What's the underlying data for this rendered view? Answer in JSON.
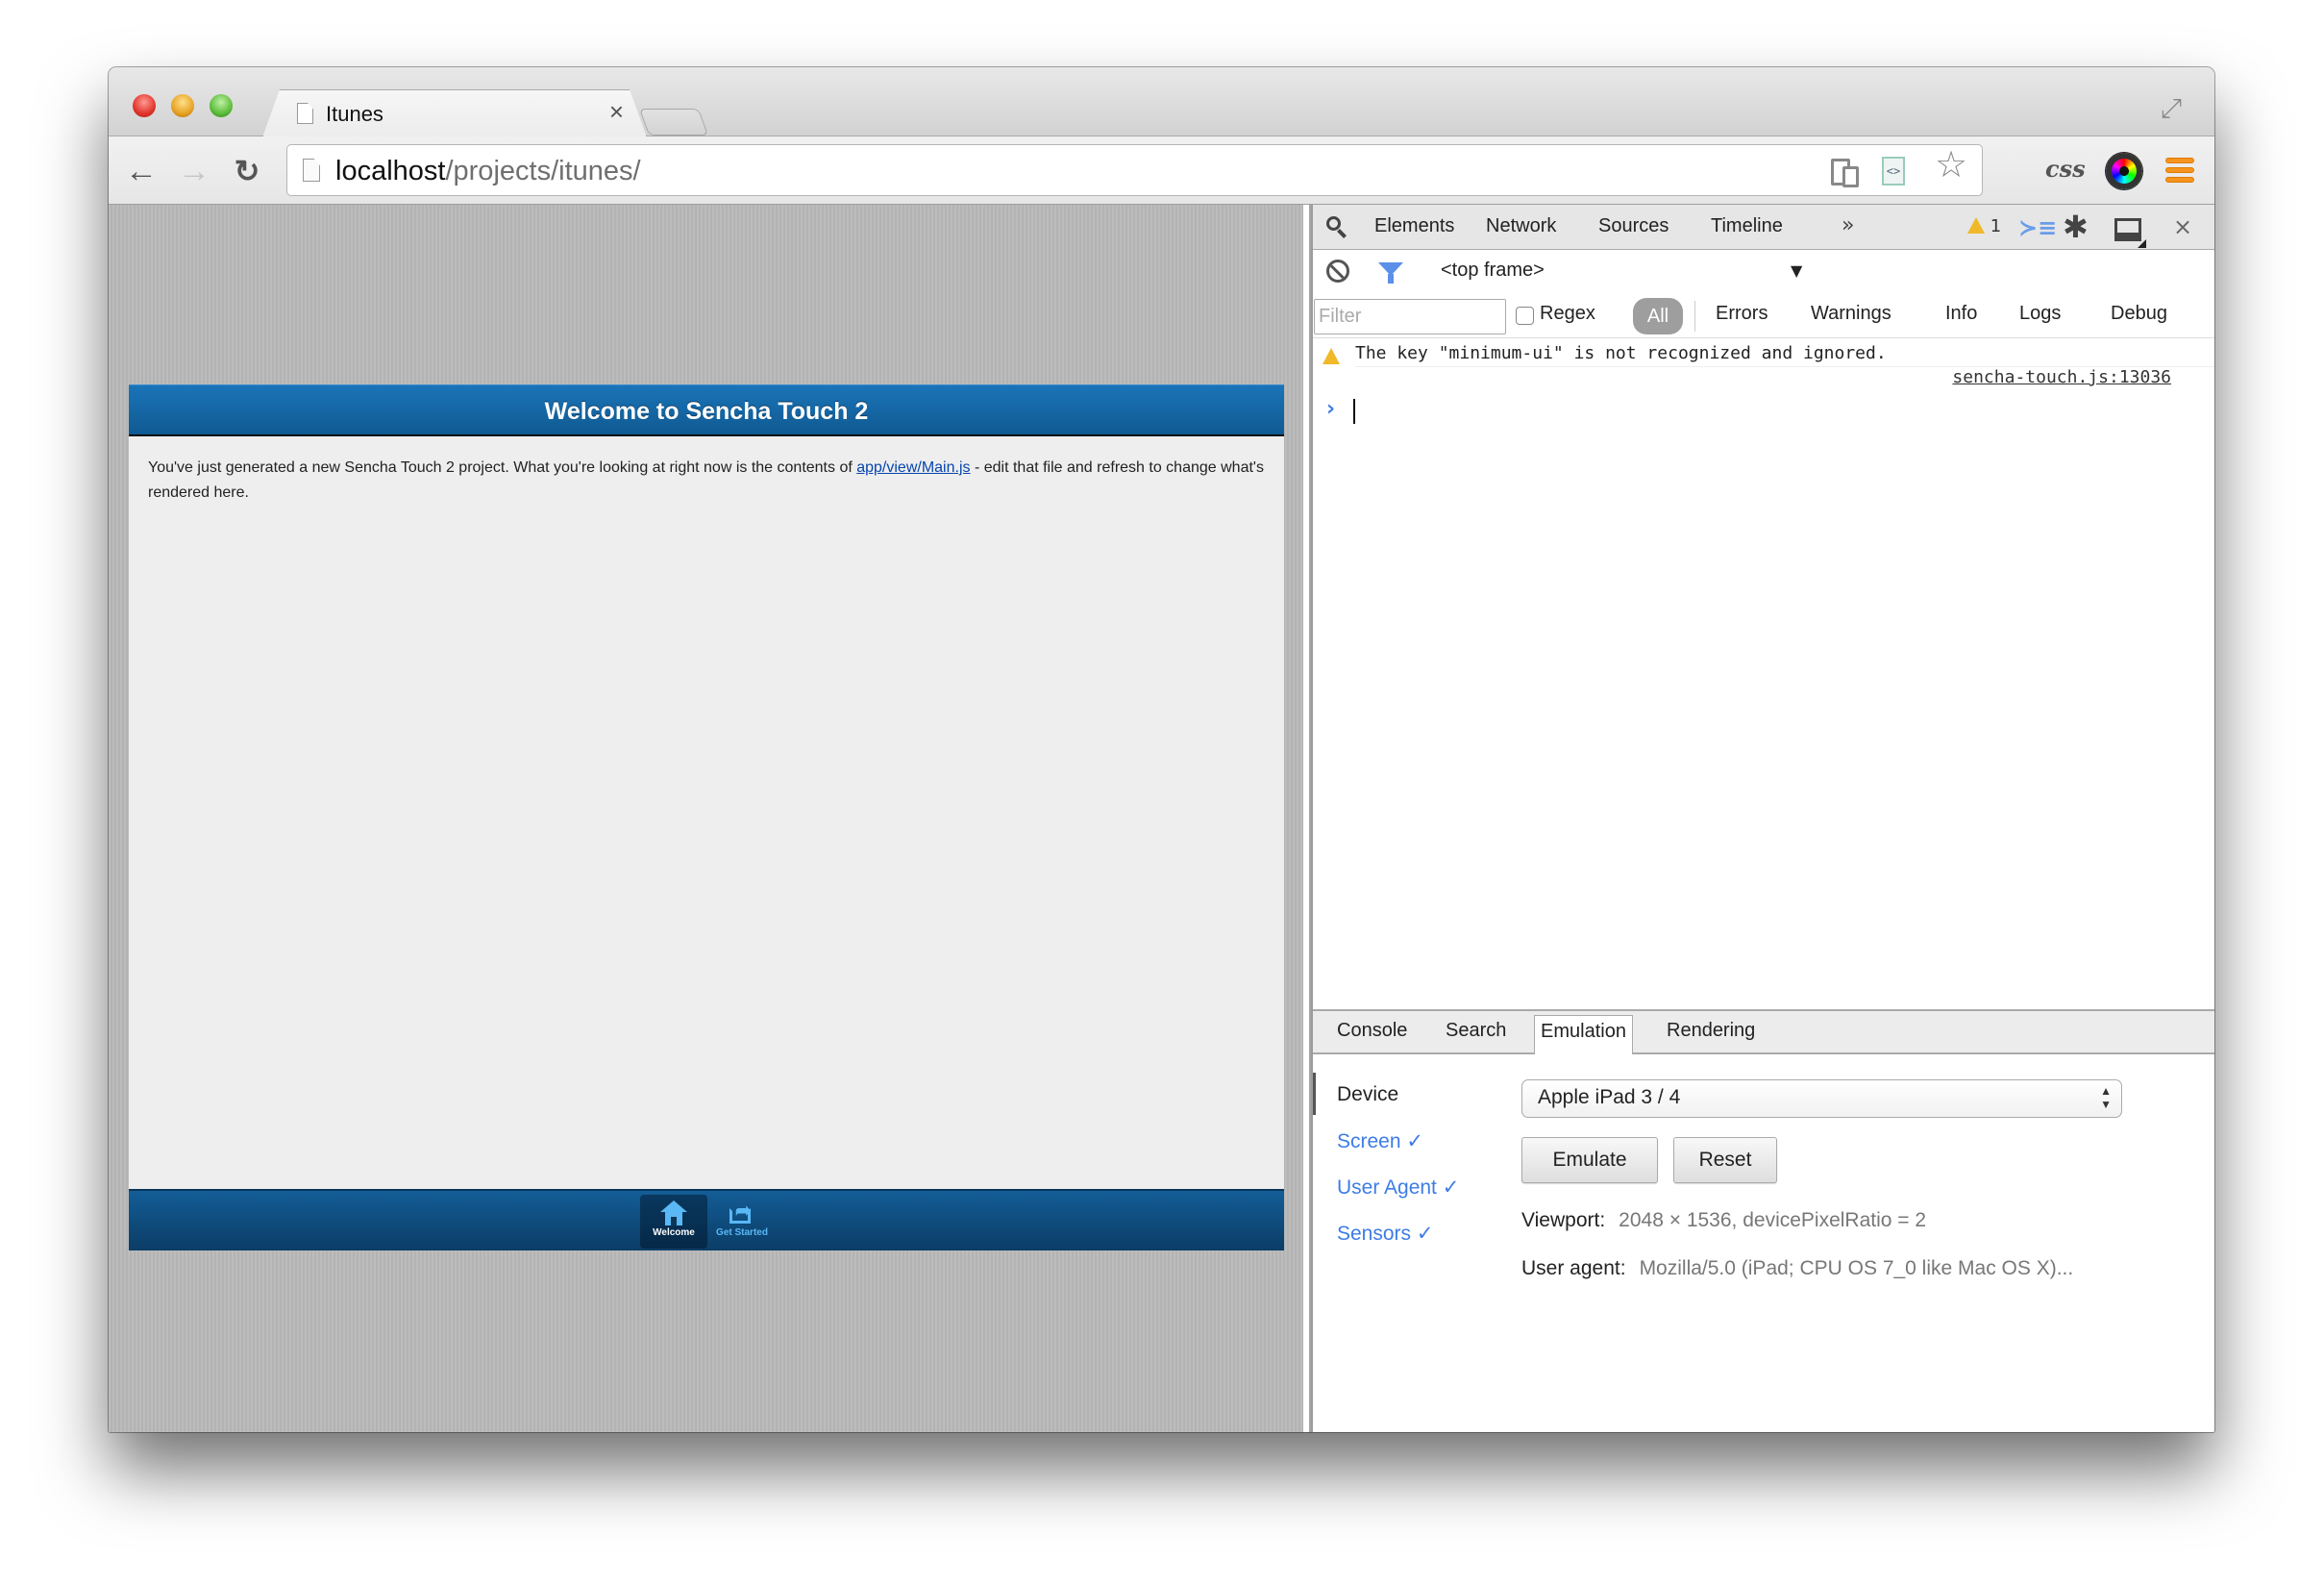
{
  "browser": {
    "tab": {
      "title": "Itunes",
      "close_glyph": "×"
    },
    "omnibox": {
      "host": "localhost",
      "path": "/projects/itunes/"
    },
    "icons": {
      "back": "←",
      "forward": "→",
      "reload": "↻",
      "star": "☆",
      "fullscreen": "⤢",
      "css_extension": "css"
    }
  },
  "page": {
    "header_title": "Welcome to Sencha Touch 2",
    "body_text_before": "You've just generated a new Sencha Touch 2 project. What you're looking at right now is the contents of ",
    "body_link": "app/view/Main.js",
    "body_text_after": " - edit that file and refresh to change what's rendered here.",
    "tabbar": [
      {
        "label": "Welcome",
        "icon": "home-icon",
        "active": true
      },
      {
        "label": "Get Started",
        "icon": "share-icon",
        "active": false
      }
    ]
  },
  "devtools": {
    "tabs": [
      "Elements",
      "Network",
      "Sources",
      "Timeline"
    ],
    "more_glyph": "»",
    "warning_count": "1",
    "close_glyph": "×",
    "gear_glyph": "✱",
    "drawer_glyph": "≻≡",
    "frame_selector": "<top frame>",
    "frame_arrow": "▼",
    "filter_placeholder": "Filter",
    "regex_label": "Regex",
    "levels": [
      "All",
      "Errors",
      "Warnings",
      "Info",
      "Logs",
      "Debug"
    ],
    "active_level": "All",
    "console_message": {
      "level": "warning",
      "text": "The key \"minimum-ui\" is not recognized and ignored.",
      "source": "sencha-touch.js:13036"
    },
    "prompt_glyph": "›",
    "drawer_tabs": [
      "Console",
      "Search",
      "Emulation",
      "Rendering"
    ],
    "active_drawer_tab": "Emulation",
    "emulation": {
      "sidebar": [
        {
          "label": "Device",
          "active": true
        },
        {
          "label": "Screen ✓",
          "active": false
        },
        {
          "label": "User Agent ✓",
          "active": false
        },
        {
          "label": "Sensors ✓",
          "active": false
        }
      ],
      "device_selected": "Apple iPad 3 / 4",
      "select_arrows": "▲▼",
      "emulate_label": "Emulate",
      "reset_label": "Reset",
      "viewport_label": "Viewport:",
      "viewport_value": "2048 × 1536, devicePixelRatio = 2",
      "user_agent_label": "User agent:",
      "user_agent_value": "Mozilla/5.0 (iPad; CPU OS 7_0 like Mac OS X)..."
    }
  },
  "colors": {
    "sencha_header": "#1a74b8",
    "sencha_tabbar": "#0b3d66",
    "link_blue": "#3d7ce6",
    "warning_yellow": "#f0b92a",
    "menu_orange": "#f7941d"
  }
}
